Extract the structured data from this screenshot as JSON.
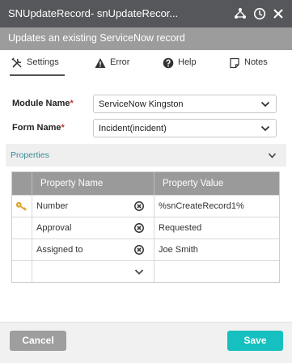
{
  "window": {
    "title": "SNUpdateRecord- snUpdateRecor...",
    "subtitle": "Updates an existing ServiceNow record"
  },
  "tabs": [
    {
      "label": "Settings",
      "icon": "tools-icon",
      "active": true
    },
    {
      "label": "Error",
      "icon": "warning-icon",
      "active": false
    },
    {
      "label": "Help",
      "icon": "help-icon",
      "active": false
    },
    {
      "label": "Notes",
      "icon": "note-icon",
      "active": false
    }
  ],
  "form": {
    "module_label": "Module Name",
    "module_value": "ServiceNow Kingston",
    "form_label": "Form Name",
    "form_value": "Incident(incident)",
    "required_mark": "*"
  },
  "properties": {
    "section_label": "Properties",
    "columns": [
      "Property Name",
      "Property Value"
    ],
    "rows": [
      {
        "name": "Number",
        "value": "%snCreateRecord1%",
        "key": true
      },
      {
        "name": "Approval",
        "value": "Requested",
        "key": false
      },
      {
        "name": "Assigned to",
        "value": "Joe Smith",
        "key": false
      }
    ]
  },
  "footer": {
    "cancel_label": "Cancel",
    "save_label": "Save"
  },
  "colors": {
    "titlebar": "#55575a",
    "subbar": "#9c9c9c",
    "accent": "#17c0c0",
    "section_label": "#3a8c96",
    "key_icon": "#e0a52a"
  }
}
